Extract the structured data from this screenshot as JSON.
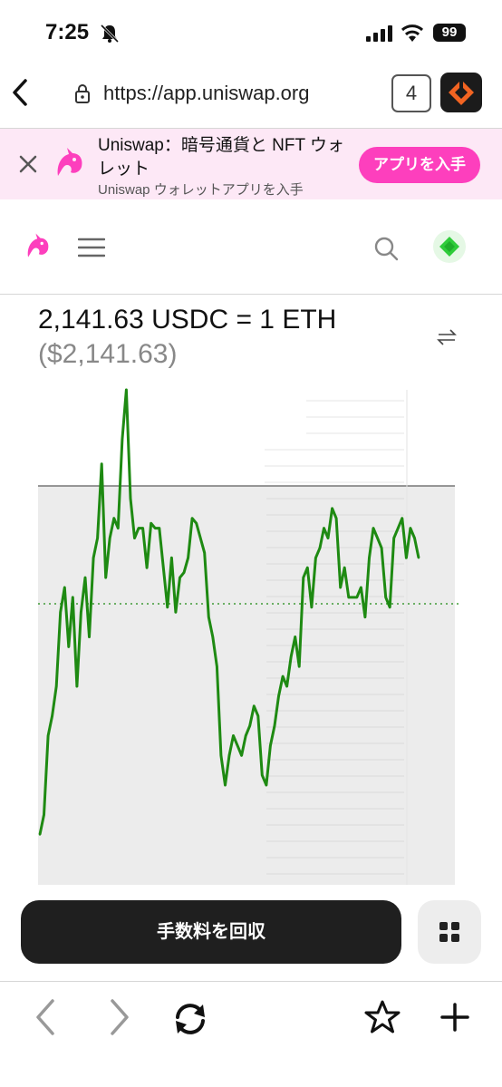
{
  "status": {
    "time": "7:25",
    "battery": "99"
  },
  "browser": {
    "url": "https://app.uniswap.org",
    "tab_count": "4"
  },
  "banner": {
    "title": "Uniswap：暗号通貨と NFT ウォレット",
    "subtitle": "Uniswap ウォレットアプリを入手",
    "button": "アプリを入手"
  },
  "price": {
    "rate": "2,141.63 USDC = 1 ETH",
    "usd": "($2,141.63)"
  },
  "chart_data": {
    "type": "line",
    "title": "",
    "xlabel": "",
    "ylabel": "",
    "grid": false,
    "current_value": 2141.63,
    "x": [
      0,
      5,
      10,
      15,
      20,
      25,
      30,
      35,
      40,
      45,
      50,
      55,
      60,
      65,
      70,
      75,
      80,
      85,
      90,
      95,
      100,
      105,
      110,
      115,
      120,
      125,
      130,
      135,
      140,
      145,
      150,
      155,
      160,
      165,
      170,
      175,
      180,
      185,
      190,
      195,
      200,
      205,
      210,
      215,
      220,
      225,
      230,
      235,
      240,
      245,
      250,
      255,
      260,
      265,
      270,
      275,
      280,
      285,
      290,
      295,
      300,
      305,
      310,
      315,
      320,
      325,
      330,
      335,
      340,
      345,
      350,
      355,
      360,
      365,
      370,
      375,
      380,
      385,
      390,
      395,
      400,
      405,
      410,
      415,
      420,
      425,
      430,
      435,
      440,
      445,
      450,
      455,
      460
    ],
    "values": [
      10,
      14,
      30,
      34,
      40,
      55,
      60,
      48,
      58,
      40,
      55,
      62,
      50,
      66,
      70,
      85,
      62,
      70,
      74,
      72,
      90,
      100,
      78,
      70,
      72,
      72,
      64,
      73,
      72,
      72,
      64,
      56,
      66,
      55,
      62,
      63,
      66,
      74,
      73,
      70,
      67,
      54,
      50,
      44,
      26,
      20,
      26,
      30,
      28,
      26,
      30,
      32,
      36,
      34,
      22,
      20,
      28,
      32,
      38,
      42,
      40,
      46,
      50,
      44,
      62,
      64,
      56,
      66,
      68,
      72,
      70,
      76,
      74,
      60,
      64,
      58,
      58,
      58,
      60,
      54,
      66,
      72,
      70,
      68,
      58,
      56,
      70,
      72,
      74,
      66,
      72,
      70,
      66
    ]
  },
  "actions": {
    "collect_label": "手数料を回収"
  },
  "colors": {
    "accent": "#fd3fbd",
    "line": "#1e8a12",
    "button_dark": "#1f1f1f"
  },
  "icons": [
    "bell-slash-icon",
    "signal-icon",
    "wifi-icon",
    "back-chevron-icon",
    "lock-icon",
    "extension-icon",
    "close-icon",
    "unicorn-logo-icon",
    "menu-icon",
    "search-icon",
    "wallet-diamond-icon",
    "swap-arrows-icon",
    "grid-icon",
    "star-icon",
    "plus-icon",
    "sync-icon",
    "forward-chevron-icon"
  ]
}
